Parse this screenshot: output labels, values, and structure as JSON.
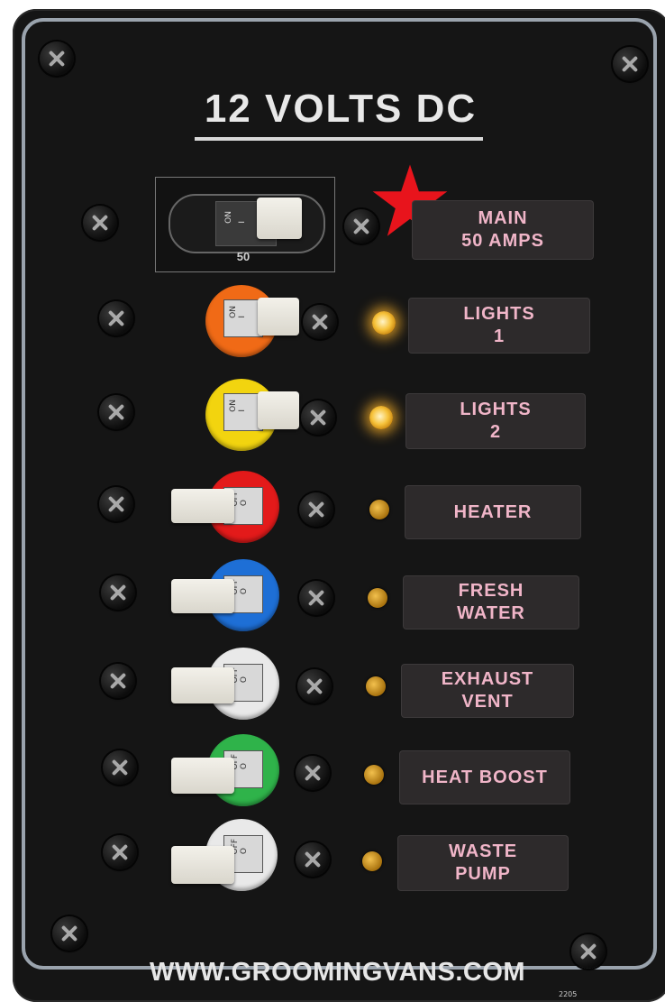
{
  "panel": {
    "title": "12 VOLTS DC",
    "website": "WWW.GROOMINGVANS.COM",
    "model_mark": "2205"
  },
  "main_breaker": {
    "rating": "50",
    "switch_marks": [
      "ON",
      "I"
    ],
    "label_line1": "MAIN",
    "label_line2": "50  AMPS"
  },
  "colors": {
    "panel": "#151515",
    "label_text": "#f0b5c8",
    "star": "#e8141c",
    "orange": "#f06a16",
    "yellow": "#f2d40f",
    "red": "#e31a1a",
    "blue": "#1e6fd6",
    "white": "#e9e9e9",
    "green": "#2fb34a"
  },
  "circuits": [
    {
      "label_line1": "LIGHTS",
      "label_line2": "1",
      "state_text": "ON",
      "state_symbol": "I",
      "indicator": "lit",
      "ring_color": "orange"
    },
    {
      "label_line1": "LIGHTS",
      "label_line2": "2",
      "state_text": "ON",
      "state_symbol": "I",
      "indicator": "lit",
      "ring_color": "yellow"
    },
    {
      "label_line1": "HEATER",
      "label_line2": "",
      "state_text": "OFF",
      "state_symbol": "O",
      "indicator": "unlit",
      "ring_color": "red"
    },
    {
      "label_line1": "FRESH",
      "label_line2": "WATER",
      "state_text": "OFF",
      "state_symbol": "O",
      "indicator": "unlit",
      "ring_color": "blue"
    },
    {
      "label_line1": "EXHAUST",
      "label_line2": "VENT",
      "state_text": "OFF",
      "state_symbol": "O",
      "indicator": "unlit",
      "ring_color": "white"
    },
    {
      "label_line1": "HEAT  BOOST",
      "label_line2": "",
      "state_text": "OFF",
      "state_symbol": "O",
      "indicator": "unlit",
      "ring_color": "green"
    },
    {
      "label_line1": "WASTE",
      "label_line2": "PUMP",
      "state_text": "OFF",
      "state_symbol": "O",
      "indicator": "unlit",
      "ring_color": "white"
    }
  ]
}
